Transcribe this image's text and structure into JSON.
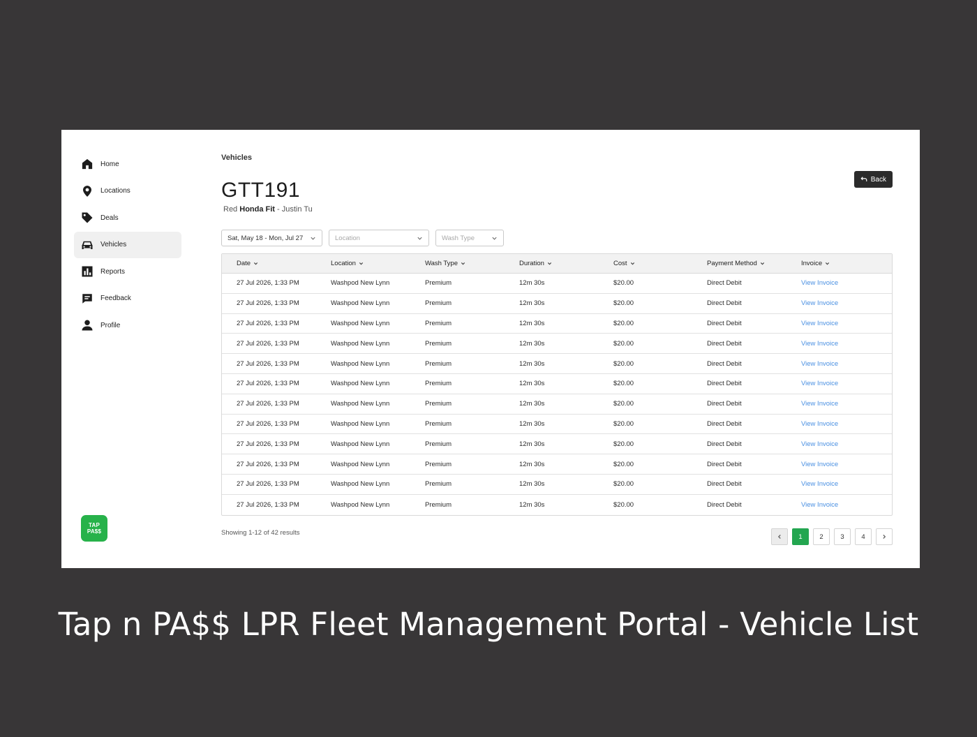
{
  "caption": "Tap n PA$$ LPR Fleet Management Portal - Vehicle List",
  "sidebar": {
    "items": [
      {
        "label": "Home",
        "icon": "home-icon"
      },
      {
        "label": "Locations",
        "icon": "location-pin-icon"
      },
      {
        "label": "Deals",
        "icon": "tag-icon"
      },
      {
        "label": "Vehicles",
        "icon": "car-icon",
        "active": true
      },
      {
        "label": "Reports",
        "icon": "bar-chart-icon"
      },
      {
        "label": "Feedback",
        "icon": "chat-icon"
      },
      {
        "label": "Profile",
        "icon": "user-icon"
      }
    ],
    "logo_line1": "TAP",
    "logo_line2": "PA$$",
    "logo_color": "#27b24a"
  },
  "header": {
    "breadcrumb": "Vehicles",
    "back_label": "Back",
    "plate": "GTT191",
    "vehicle_prefix": "Red ",
    "vehicle_make": "Honda Fit",
    "vehicle_owner": " - Justin Tu"
  },
  "filters": {
    "date_range": "Sat, May 18 - Mon, Jul 27",
    "location_placeholder": "Location",
    "wash_type_placeholder": "Wash Type"
  },
  "table": {
    "columns": [
      "Date",
      "Location",
      "Wash Type",
      "Duration",
      "Cost",
      "Payment Method",
      "Invoice"
    ],
    "rows": [
      [
        "27 Jul 2026, 1:33 PM",
        "Washpod New Lynn",
        "Premium",
        "12m 30s",
        "$20.00",
        "Direct Debit",
        "View Invoice"
      ],
      [
        "27 Jul 2026, 1:33 PM",
        "Washpod New Lynn",
        "Premium",
        "12m 30s",
        "$20.00",
        "Direct Debit",
        "View Invoice"
      ],
      [
        "27 Jul 2026, 1:33 PM",
        "Washpod New Lynn",
        "Premium",
        "12m 30s",
        "$20.00",
        "Direct Debit",
        "View Invoice"
      ],
      [
        "27 Jul 2026, 1:33 PM",
        "Washpod New Lynn",
        "Premium",
        "12m 30s",
        "$20.00",
        "Direct Debit",
        "View Invoice"
      ],
      [
        "27 Jul 2026, 1:33 PM",
        "Washpod New Lynn",
        "Premium",
        "12m 30s",
        "$20.00",
        "Direct Debit",
        "View Invoice"
      ],
      [
        "27 Jul 2026, 1:33 PM",
        "Washpod New Lynn",
        "Premium",
        "12m 30s",
        "$20.00",
        "Direct Debit",
        "View Invoice"
      ],
      [
        "27 Jul 2026, 1:33 PM",
        "Washpod New Lynn",
        "Premium",
        "12m 30s",
        "$20.00",
        "Direct Debit",
        "View Invoice"
      ],
      [
        "27 Jul 2026, 1:33 PM",
        "Washpod New Lynn",
        "Premium",
        "12m 30s",
        "$20.00",
        "Direct Debit",
        "View Invoice"
      ],
      [
        "27 Jul 2026, 1:33 PM",
        "Washpod New Lynn",
        "Premium",
        "12m 30s",
        "$20.00",
        "Direct Debit",
        "View Invoice"
      ],
      [
        "27 Jul 2026, 1:33 PM",
        "Washpod New Lynn",
        "Premium",
        "12m 30s",
        "$20.00",
        "Direct Debit",
        "View Invoice"
      ],
      [
        "27 Jul 2026, 1:33 PM",
        "Washpod New Lynn",
        "Premium",
        "12m 30s",
        "$20.00",
        "Direct Debit",
        "View Invoice"
      ],
      [
        "27 Jul 2026, 1:33 PM",
        "Washpod New Lynn",
        "Premium",
        "12m 30s",
        "$20.00",
        "Direct Debit",
        "View Invoice"
      ]
    ],
    "link_color": "#4a90e2"
  },
  "footer": {
    "showing": "Showing 1-12 of 42 results",
    "pages": [
      "1",
      "2",
      "3",
      "4"
    ],
    "current_page": "1",
    "accent_color": "#23a650"
  }
}
